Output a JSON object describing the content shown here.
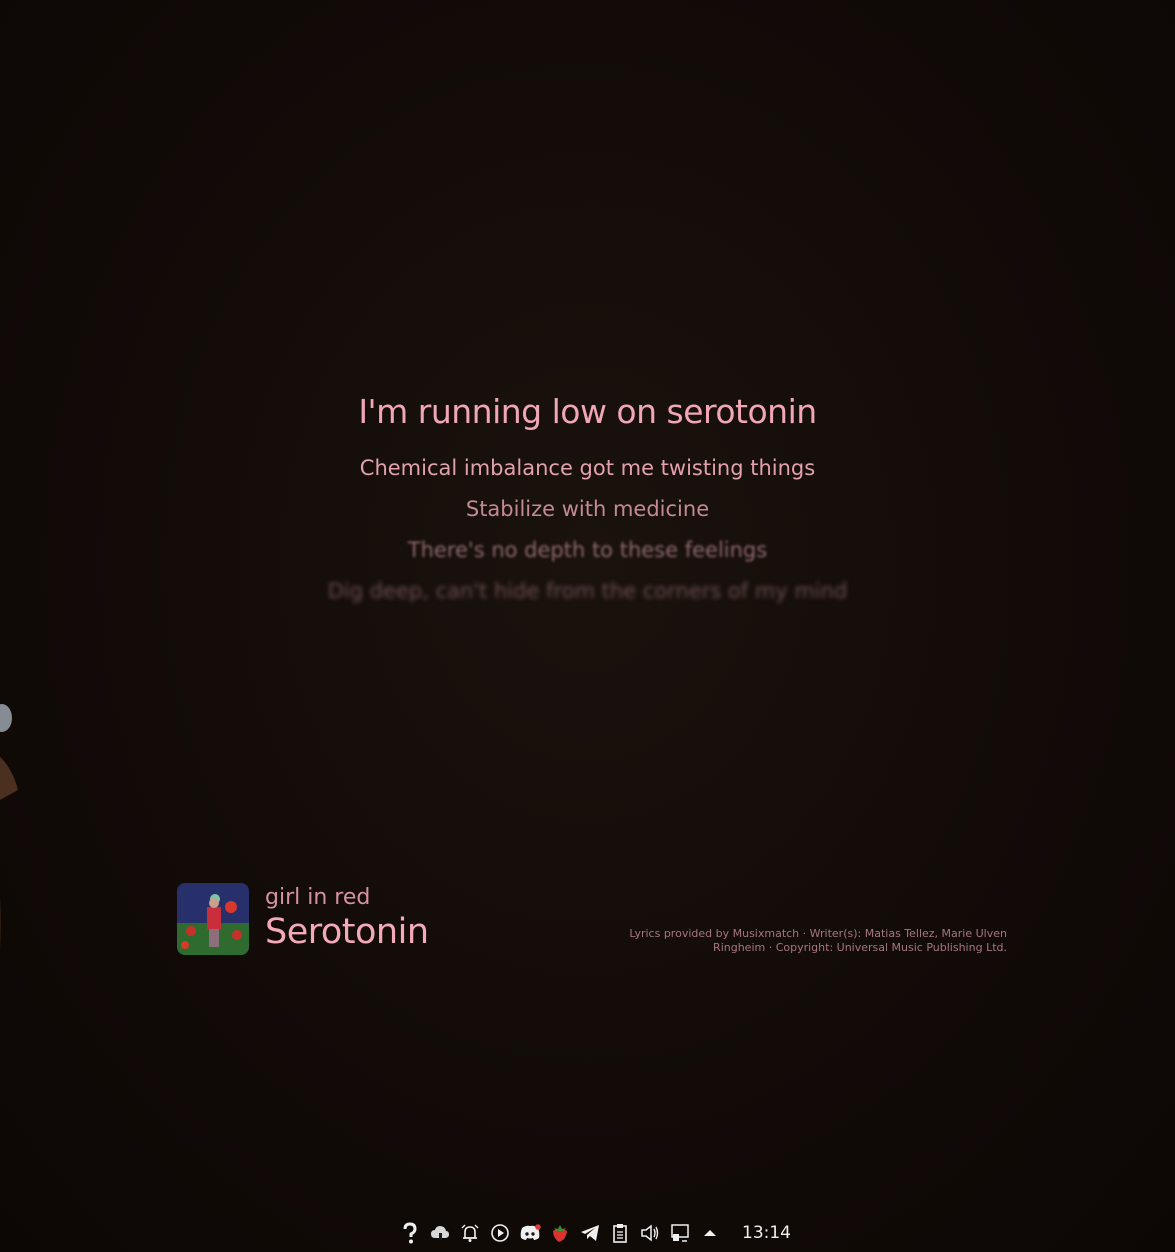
{
  "lyrics": {
    "active": "I'm running low on serotonin",
    "upcoming": [
      "Chemical imbalance got me twisting things",
      "Stabilize with medicine",
      "There's no depth to these feelings",
      "Dig deep, can't hide from the corners of my mind",
      "",
      ""
    ]
  },
  "now_playing": {
    "artist": "girl in red",
    "title": "Serotonin"
  },
  "credits": "Lyrics provided by Musixmatch · Writer(s): Matias Tellez, Marie Ulven Ringheim · Copyright: Universal Music Publishing Ltd.",
  "taskbar": {
    "tray_icons": [
      "help-icon",
      "cloud-icon",
      "bell-icon",
      "play-circle-icon",
      "discord-icon",
      "strawberry-icon",
      "telegram-icon",
      "clipboard-icon",
      "volume-icon",
      "network-icon",
      "chevron-up-icon"
    ],
    "clock": "13:14"
  },
  "colors": {
    "accent": "#f0a6b4",
    "background": "#120b08"
  }
}
